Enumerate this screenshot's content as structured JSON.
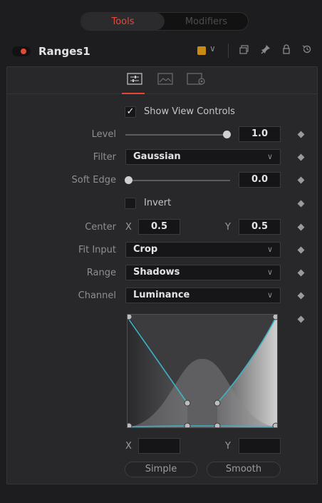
{
  "tabs": {
    "tools": "Tools",
    "modifiers": "Modifiers"
  },
  "header": {
    "tool_name": "Ranges1",
    "swatch_color": "#c88a15",
    "chevron": "∨"
  },
  "icons": {
    "header": [
      "chevron-down-icon",
      "layers-icon",
      "pin-icon",
      "lock-icon",
      "reset-icon"
    ],
    "subtabs": [
      "controls-tab-icon",
      "image-tab-icon",
      "settings-tab-icon"
    ]
  },
  "controls": {
    "show_view_controls": "Show View Controls",
    "show_view_controls_checked": true,
    "level": {
      "label": "Level",
      "value": "1.0",
      "fraction": 1.0
    },
    "filter": {
      "label": "Filter",
      "value": "Gaussian"
    },
    "soft_edge": {
      "label": "Soft Edge",
      "value": "0.0",
      "fraction": 0.0
    },
    "invert": {
      "label": "Invert",
      "checked": false
    },
    "center": {
      "label": "Center",
      "x_label": "X",
      "x_value": "0.5",
      "y_label": "Y",
      "y_value": "0.5"
    },
    "fit_input": {
      "label": "Fit Input",
      "value": "Crop"
    },
    "range": {
      "label": "Range",
      "value": "Shadows"
    },
    "channel": {
      "label": "Channel",
      "value": "Luminance"
    }
  },
  "curve": {
    "x_label": "X",
    "x_value": "",
    "y_label": "Y",
    "y_value": "",
    "simple_button": "Simple",
    "smooth_button": "Smooth",
    "accent_color": "#3bb4c8"
  }
}
